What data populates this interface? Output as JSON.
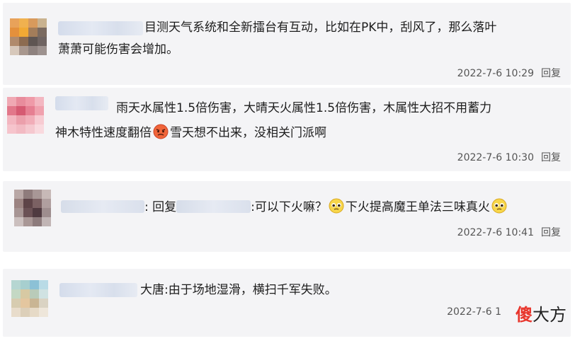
{
  "comments": [
    {
      "text_lines": [
        "目测天气系统和全新擂台有互动，比如在PK中，刮风了，那么落叶",
        "萧萧可能伤害会增加。"
      ],
      "timestamp": "2022-7-6 10:29",
      "reply_label": "回复"
    },
    {
      "text_line1": "雨天水属性1.5倍伤害，大晴天火属性1.5倍伤害，木属性大招不用蓄力",
      "text_line2a": "神木特性速度翻倍",
      "text_line2b": "雪天想不出来，没相关门派啊",
      "timestamp": "2022-7-6 10:30",
      "reply_label": "回复"
    },
    {
      "colon": ":",
      "reply_prefix": "回复",
      "text_a": ":可以下火嘛？",
      "text_b": "下火提高魔王单法三味真火",
      "timestamp": "2022-7-6 10:41",
      "reply_label": "回复"
    },
    {
      "text": "大唐:由于场地湿滑，横扫千军失败。",
      "timestamp": "2022-7-6 1"
    }
  ],
  "watermark": {
    "part1": "傻",
    "part2": "大方"
  },
  "colors": {
    "card_bg": "#f4f4f6",
    "text": "#1d1d1d",
    "meta": "#555555",
    "watermark_red": "#e8352c"
  }
}
